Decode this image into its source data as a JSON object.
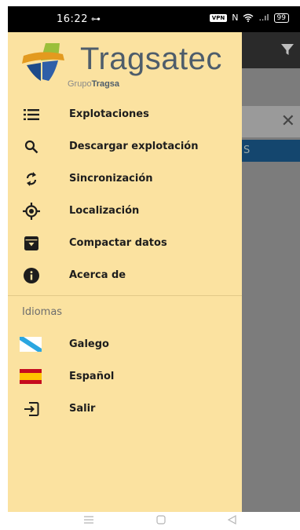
{
  "status": {
    "time": "16:22",
    "key_glyph": "⊶",
    "vpn": "VPN",
    "nfc": "N",
    "signal": "..ıl",
    "battery": "99"
  },
  "brand": {
    "name": "Tragsatec",
    "sub_prefix": "Grupo",
    "sub_bold": "Tragsa"
  },
  "menu": [
    {
      "id": "explotaciones",
      "icon": "list-icon",
      "label": "Explotaciones"
    },
    {
      "id": "descargar",
      "icon": "search-icon",
      "label": "Descargar explotación"
    },
    {
      "id": "sincronizacion",
      "icon": "sync-icon",
      "label": "Sincronización"
    },
    {
      "id": "localizacion",
      "icon": "location-icon",
      "label": "Localización"
    },
    {
      "id": "compactar",
      "icon": "archive-icon",
      "label": "Compactar datos"
    },
    {
      "id": "acerca",
      "icon": "info-icon",
      "label": "Acerca de"
    }
  ],
  "languages": {
    "section_title": "Idiomas",
    "items": [
      {
        "id": "galego",
        "icon": "galicia-flag-icon",
        "label": "Galego"
      },
      {
        "id": "espanol",
        "icon": "spain-flag-icon",
        "label": "Español"
      },
      {
        "id": "salir",
        "icon": "logout-icon",
        "label": "Salir"
      }
    ]
  },
  "background": {
    "tab_text": "S"
  },
  "colors": {
    "drawer_bg": "#fbe2a0",
    "bg_tab": "#14466e"
  }
}
